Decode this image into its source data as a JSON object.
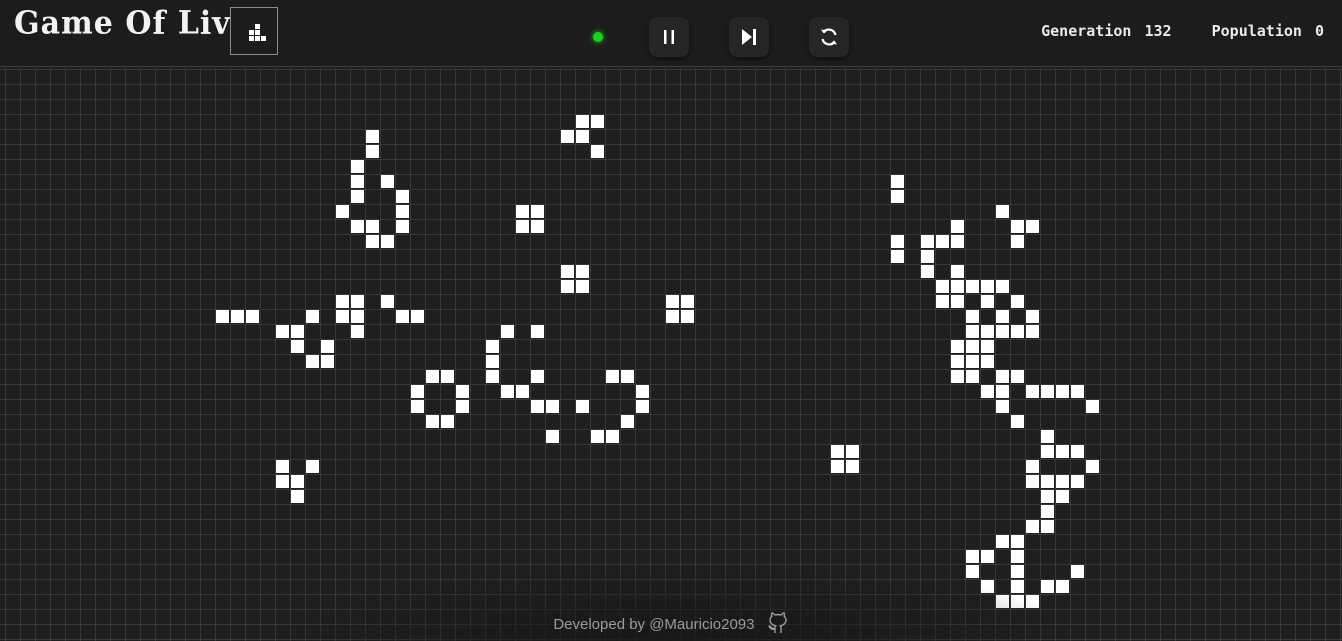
{
  "header": {
    "title": "Game Of Live",
    "pattern_icon": "pattern-cells-icon",
    "status_color": "#19d219",
    "controls": [
      {
        "name": "pause-button",
        "icon": "pause-icon"
      },
      {
        "name": "step-button",
        "icon": "step-forward-icon"
      },
      {
        "name": "reset-button",
        "icon": "refresh-icon"
      }
    ],
    "generation_label": "Generation",
    "generation_value": "132",
    "population_label": "Population",
    "population_value": "0"
  },
  "board": {
    "live_color": "#ffffff",
    "grid_color": "#383838",
    "live_cells": [
      [
        24,
        4
      ],
      [
        24,
        5
      ],
      [
        23,
        6
      ],
      [
        23,
        7
      ],
      [
        25,
        7
      ],
      [
        23,
        8
      ],
      [
        26,
        8
      ],
      [
        22,
        9
      ],
      [
        26,
        9
      ],
      [
        23,
        10
      ],
      [
        24,
        10
      ],
      [
        26,
        10
      ],
      [
        24,
        11
      ],
      [
        25,
        11
      ],
      [
        38,
        3
      ],
      [
        39,
        3
      ],
      [
        37,
        4
      ],
      [
        38,
        4
      ],
      [
        39,
        5
      ],
      [
        34,
        9
      ],
      [
        35,
        9
      ],
      [
        34,
        10
      ],
      [
        35,
        10
      ],
      [
        37,
        13
      ],
      [
        38,
        13
      ],
      [
        37,
        14
      ],
      [
        38,
        14
      ],
      [
        44,
        15
      ],
      [
        45,
        15
      ],
      [
        44,
        16
      ],
      [
        45,
        16
      ],
      [
        14,
        16
      ],
      [
        15,
        16
      ],
      [
        16,
        16
      ],
      [
        22,
        15
      ],
      [
        23,
        15
      ],
      [
        22,
        16
      ],
      [
        23,
        16
      ],
      [
        23,
        17
      ],
      [
        20,
        16
      ],
      [
        18,
        17
      ],
      [
        19,
        17
      ],
      [
        19,
        18
      ],
      [
        21,
        18
      ],
      [
        20,
        19
      ],
      [
        21,
        19
      ],
      [
        25,
        15
      ],
      [
        26,
        16
      ],
      [
        27,
        16
      ],
      [
        33,
        17
      ],
      [
        35,
        17
      ],
      [
        32,
        18
      ],
      [
        32,
        19
      ],
      [
        32,
        20
      ],
      [
        35,
        20
      ],
      [
        33,
        21
      ],
      [
        34,
        21
      ],
      [
        35,
        22
      ],
      [
        36,
        22
      ],
      [
        38,
        22
      ],
      [
        36,
        24
      ],
      [
        28,
        20
      ],
      [
        29,
        20
      ],
      [
        27,
        21
      ],
      [
        30,
        21
      ],
      [
        27,
        22
      ],
      [
        30,
        22
      ],
      [
        28,
        23
      ],
      [
        29,
        23
      ],
      [
        40,
        20
      ],
      [
        41,
        20
      ],
      [
        42,
        21
      ],
      [
        42,
        22
      ],
      [
        41,
        23
      ],
      [
        39,
        24
      ],
      [
        40,
        24
      ],
      [
        18,
        26
      ],
      [
        20,
        26
      ],
      [
        18,
        27
      ],
      [
        19,
        27
      ],
      [
        19,
        28
      ],
      [
        55,
        25
      ],
      [
        56,
        25
      ],
      [
        55,
        26
      ],
      [
        56,
        26
      ],
      [
        59,
        7
      ],
      [
        59,
        8
      ],
      [
        59,
        11
      ],
      [
        59,
        12
      ],
      [
        66,
        9
      ],
      [
        63,
        10
      ],
      [
        67,
        10
      ],
      [
        68,
        10
      ],
      [
        61,
        11
      ],
      [
        62,
        11
      ],
      [
        63,
        11
      ],
      [
        67,
        11
      ],
      [
        61,
        12
      ],
      [
        61,
        13
      ],
      [
        63,
        13
      ],
      [
        62,
        14
      ],
      [
        63,
        14
      ],
      [
        64,
        14
      ],
      [
        65,
        14
      ],
      [
        66,
        14
      ],
      [
        62,
        15
      ],
      [
        63,
        15
      ],
      [
        65,
        15
      ],
      [
        67,
        15
      ],
      [
        64,
        16
      ],
      [
        66,
        16
      ],
      [
        68,
        16
      ],
      [
        64,
        17
      ],
      [
        65,
        17
      ],
      [
        66,
        17
      ],
      [
        67,
        17
      ],
      [
        68,
        17
      ],
      [
        63,
        18
      ],
      [
        64,
        18
      ],
      [
        65,
        18
      ],
      [
        63,
        19
      ],
      [
        64,
        19
      ],
      [
        65,
        19
      ],
      [
        63,
        20
      ],
      [
        64,
        20
      ],
      [
        66,
        20
      ],
      [
        67,
        20
      ],
      [
        65,
        21
      ],
      [
        66,
        21
      ],
      [
        68,
        21
      ],
      [
        69,
        21
      ],
      [
        70,
        21
      ],
      [
        71,
        21
      ],
      [
        66,
        22
      ],
      [
        72,
        22
      ],
      [
        67,
        23
      ],
      [
        69,
        24
      ],
      [
        69,
        25
      ],
      [
        70,
        25
      ],
      [
        71,
        25
      ],
      [
        68,
        26
      ],
      [
        72,
        26
      ],
      [
        68,
        27
      ],
      [
        69,
        27
      ],
      [
        70,
        27
      ],
      [
        71,
        27
      ],
      [
        69,
        28
      ],
      [
        70,
        28
      ],
      [
        69,
        29
      ],
      [
        68,
        30
      ],
      [
        69,
        30
      ],
      [
        66,
        31
      ],
      [
        67,
        31
      ],
      [
        64,
        32
      ],
      [
        65,
        32
      ],
      [
        67,
        32
      ],
      [
        64,
        33
      ],
      [
        67,
        33
      ],
      [
        71,
        33
      ],
      [
        65,
        34
      ],
      [
        67,
        34
      ],
      [
        69,
        34
      ],
      [
        70,
        34
      ],
      [
        66,
        35
      ],
      [
        67,
        35
      ],
      [
        68,
        35
      ]
    ]
  },
  "footer": {
    "text": "Developed by @Mauricio2093",
    "icon": "github-icon"
  }
}
